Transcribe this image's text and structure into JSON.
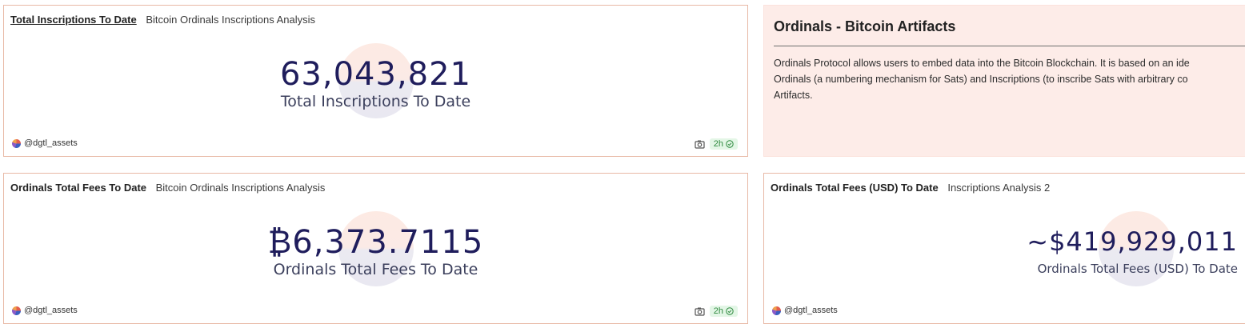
{
  "cards": {
    "inscriptions": {
      "title": "Total Inscriptions To Date",
      "subtitle": "Bitcoin Ordinals Inscriptions Analysis",
      "value": "63,043,821",
      "label": "Total Inscriptions To Date",
      "author": "@dgtl_assets",
      "refresh": "2h"
    },
    "about": {
      "title": "Ordinals - Bitcoin Artifacts",
      "line1": "Ordinals Protocol allows users to embed data into the Bitcoin Blockchain. It is based on an ide",
      "line2": "Ordinals (a numbering mechanism for Sats) and Inscriptions (to inscribe Sats with arbitrary co",
      "line3": "Artifacts."
    },
    "fees_btc": {
      "title": "Ordinals Total Fees To Date",
      "subtitle": "Bitcoin Ordinals Inscriptions Analysis",
      "value": "₿6,373.7115",
      "label": "Ordinals Total Fees To Date",
      "author": "@dgtl_assets",
      "refresh": "2h"
    },
    "fees_usd": {
      "title": "Ordinals Total Fees (USD) To Date",
      "subtitle": "Inscriptions Analysis 2",
      "value": "~$419,929,011",
      "label": "Ordinals Total Fees (USD) To Date",
      "author": "@dgtl_assets"
    }
  },
  "icons": {
    "camera": "camera-icon",
    "check": "check-circle-icon",
    "avatar": "avatar"
  },
  "colors": {
    "card_border": "#e8b9a6",
    "text_card_bg": "#fdece8",
    "counter_value": "#1f1d5c",
    "badge_bg": "#e3f6e6",
    "badge_text": "#2f8a3f"
  }
}
